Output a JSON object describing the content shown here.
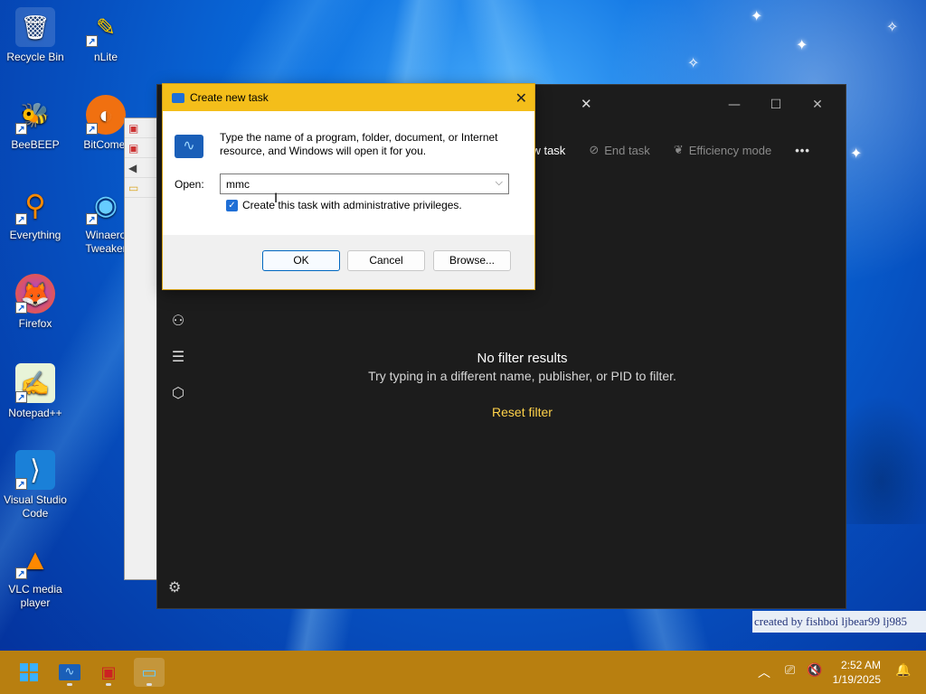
{
  "desktop": {
    "icons": [
      {
        "label": "Recycle Bin",
        "glyph": "🗑"
      },
      {
        "label": "nLite",
        "glyph": "✎"
      },
      {
        "label": "BeeBEEP",
        "glyph": "🐝"
      },
      {
        "label": "BitComet",
        "glyph": "◐"
      },
      {
        "label": "Everything",
        "glyph": "⚲"
      },
      {
        "label": "Winaero Tweaker",
        "glyph": "◉"
      },
      {
        "label": "Firefox",
        "glyph": "🦊"
      },
      {
        "label": "Notepad++",
        "glyph": "✍"
      },
      {
        "label": "Visual Studio Code",
        "glyph": "⟩"
      },
      {
        "label": "VLC media player",
        "glyph": "▲"
      }
    ],
    "credit_text": "created by fishboi ljbear99 lj985"
  },
  "task_manager": {
    "toolbar": {
      "new_task": "new task",
      "end_task": "End task",
      "efficiency_mode": "Efficiency mode",
      "more": "•••"
    },
    "empty_state": {
      "heading": "No filter results",
      "message": "Try typing in a different name, publisher, or PID to filter.",
      "reset": "Reset filter"
    }
  },
  "dialog": {
    "title": "Create new task",
    "message": "Type the name of a program, folder, document, or Internet resource, and Windows will open it for you.",
    "open_label": "Open:",
    "open_value": "mmc",
    "admin_label": "Create this task with administrative privileges.",
    "admin_checked": true,
    "ok": "OK",
    "cancel": "Cancel",
    "browse": "Browse..."
  },
  "taskbar": {
    "time": "2:52 AM",
    "date": "1/19/2025"
  },
  "colors": {
    "taskbar": "#b87f10",
    "dialog_title": "#f4be1a",
    "accent": "#0067c0",
    "reset_link": "#ffd24a"
  }
}
